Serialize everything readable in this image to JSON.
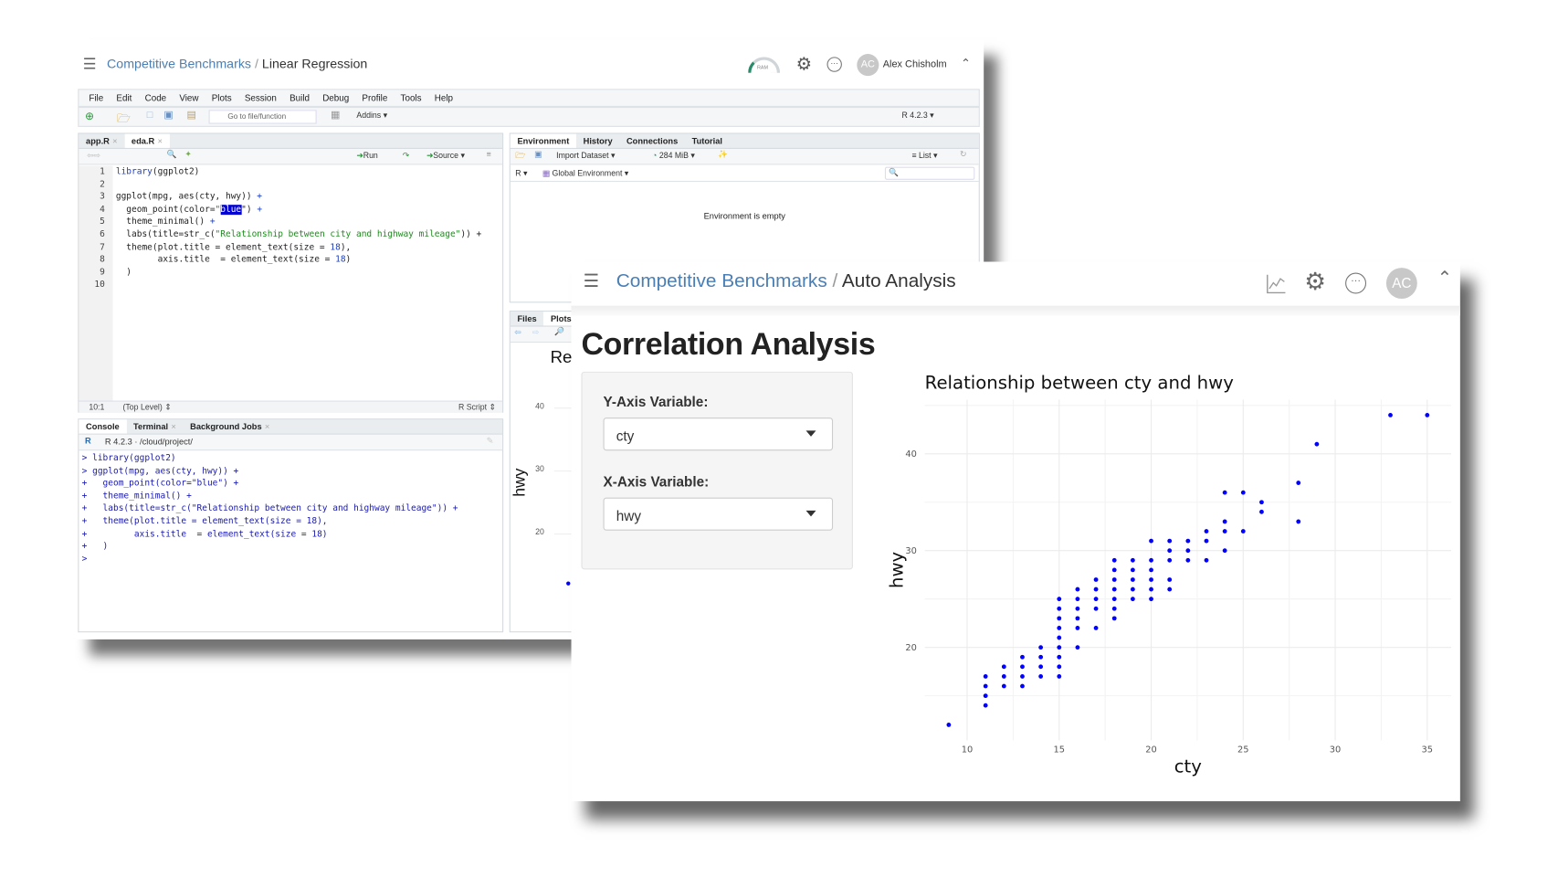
{
  "back_window": {
    "breadcrumb_parent": "Competitive Benchmarks",
    "breadcrumb_sep": "/",
    "breadcrumb_current": "Linear Regression",
    "ram_label": "RAM",
    "user_initials": "AC",
    "user_name": "Alex Chisholm",
    "menu": [
      "File",
      "Edit",
      "Code",
      "View",
      "Plots",
      "Session",
      "Build",
      "Debug",
      "Profile",
      "Tools",
      "Help"
    ],
    "toolbar": {
      "goto_placeholder": "Go to file/function",
      "addins": "Addins",
      "r_version": "R 4.2.3"
    },
    "editor": {
      "tabs": [
        "app.R",
        "eda.R"
      ],
      "run": "Run",
      "source": "Source",
      "line_numbers": [
        "1",
        "2",
        "3",
        "4",
        "5",
        "6",
        "7",
        "8",
        "9",
        "10"
      ],
      "lines": [
        [
          {
            "t": "library",
            "c": "kw"
          },
          {
            "t": "(ggplot2)",
            "c": ""
          }
        ],
        [],
        [
          {
            "t": "ggplot(mpg, aes(cty, hwy)) ",
            "c": ""
          },
          {
            "t": "+",
            "c": "kw"
          }
        ],
        [
          {
            "t": "  geom_point(color=",
            "c": ""
          },
          {
            "t": "\"",
            "c": "str"
          },
          {
            "t": "blue",
            "c": "hl"
          },
          {
            "t": "\") ",
            "c": ""
          },
          {
            "t": "+",
            "c": "kw"
          }
        ],
        [
          {
            "t": "  theme_minimal() ",
            "c": ""
          },
          {
            "t": "+",
            "c": "kw"
          }
        ],
        [
          {
            "t": "  labs(title=str_c(",
            "c": ""
          },
          {
            "t": "\"Relationship between city and highway mileage\"",
            "c": "str"
          },
          {
            "t": ")) +",
            "c": ""
          }
        ],
        [
          {
            "t": "  theme(plot.title = element_text(size = ",
            "c": ""
          },
          {
            "t": "18",
            "c": "num"
          },
          {
            "t": "),",
            "c": ""
          }
        ],
        [
          {
            "t": "        axis.title  = element_text(size = ",
            "c": ""
          },
          {
            "t": "18",
            "c": "num"
          },
          {
            "t": ")",
            "c": ""
          }
        ],
        [
          {
            "t": "  )",
            "c": ""
          }
        ],
        []
      ],
      "cursor_pos": "10:1",
      "scope": "(Top Level)",
      "file_type": "R Script"
    },
    "console": {
      "tabs": [
        "Console",
        "Terminal",
        "Background Jobs"
      ],
      "path": "R 4.2.3 · /cloud/project/",
      "lines": [
        "> library(ggplot2)",
        "> ggplot(mpg, aes(cty, hwy)) +",
        "+   geom_point(color=\"blue\") +",
        "+   theme_minimal() +",
        "+   labs(title=str_c(\"Relationship between city and highway mileage\")) +",
        "+   theme(plot.title = element_text(size = 18),",
        "+         axis.title  = element_text(size = 18)",
        "+   )",
        "> "
      ]
    },
    "environment": {
      "tabs": [
        "Environment",
        "History",
        "Connections",
        "Tutorial"
      ],
      "import_dataset": "Import Dataset",
      "memory": "284 MiB",
      "view_mode": "List",
      "language": "R",
      "scope": "Global Environment",
      "empty_message": "Environment is empty"
    },
    "files_pane": {
      "tabs": [
        "Files",
        "Plots"
      ],
      "plot_title_fragment": "Re",
      "y_ticks": [
        "40",
        "30",
        "20"
      ],
      "ylabel": "hwy"
    }
  },
  "front_window": {
    "breadcrumb_parent": "Competitive Benchmarks",
    "breadcrumb_sep": "/",
    "breadcrumb_current": "Auto Analysis",
    "user_initials": "AC",
    "page_title": "Correlation Analysis",
    "y_axis_label": "Y-Axis Variable:",
    "y_axis_value": "cty",
    "x_axis_label": "X-Axis Variable:",
    "x_axis_value": "hwy"
  },
  "chart_data": {
    "type": "scatter",
    "title": "Relationship between cty and hwy",
    "xlabel": "cty",
    "ylabel": "hwy",
    "xlim": [
      7.7,
      36.3
    ],
    "ylim": [
      10.4,
      45.6
    ],
    "x_ticks": [
      10,
      15,
      20,
      25,
      30,
      35
    ],
    "y_ticks": [
      20,
      30,
      40
    ],
    "grid": true,
    "point_color": "#0000ff",
    "points": [
      [
        9,
        12
      ],
      [
        11,
        17
      ],
      [
        11,
        16
      ],
      [
        11,
        15
      ],
      [
        11,
        14
      ],
      [
        12,
        18
      ],
      [
        12,
        17
      ],
      [
        12,
        16
      ],
      [
        13,
        19
      ],
      [
        13,
        18
      ],
      [
        13,
        17
      ],
      [
        13,
        16
      ],
      [
        14,
        20
      ],
      [
        14,
        19
      ],
      [
        14,
        18
      ],
      [
        14,
        17
      ],
      [
        15,
        25
      ],
      [
        15,
        24
      ],
      [
        15,
        23
      ],
      [
        15,
        22
      ],
      [
        15,
        21
      ],
      [
        15,
        20
      ],
      [
        15,
        19
      ],
      [
        15,
        18
      ],
      [
        15,
        17
      ],
      [
        16,
        26
      ],
      [
        16,
        25
      ],
      [
        16,
        24
      ],
      [
        16,
        23
      ],
      [
        16,
        22
      ],
      [
        16,
        20
      ],
      [
        17,
        27
      ],
      [
        17,
        26
      ],
      [
        17,
        25
      ],
      [
        17,
        24
      ],
      [
        17,
        22
      ],
      [
        18,
        29
      ],
      [
        18,
        28
      ],
      [
        18,
        27
      ],
      [
        18,
        26
      ],
      [
        18,
        25
      ],
      [
        18,
        24
      ],
      [
        18,
        23
      ],
      [
        19,
        29
      ],
      [
        19,
        28
      ],
      [
        19,
        27
      ],
      [
        19,
        26
      ],
      [
        19,
        25
      ],
      [
        20,
        31
      ],
      [
        20,
        29
      ],
      [
        20,
        28
      ],
      [
        20,
        27
      ],
      [
        20,
        26
      ],
      [
        20,
        25
      ],
      [
        21,
        31
      ],
      [
        21,
        30
      ],
      [
        21,
        29
      ],
      [
        21,
        27
      ],
      [
        21,
        26
      ],
      [
        22,
        31
      ],
      [
        22,
        30
      ],
      [
        22,
        29
      ],
      [
        23,
        32
      ],
      [
        23,
        31
      ],
      [
        23,
        29
      ],
      [
        24,
        36
      ],
      [
        24,
        33
      ],
      [
        24,
        32
      ],
      [
        24,
        30
      ],
      [
        25,
        36
      ],
      [
        25,
        32
      ],
      [
        26,
        35
      ],
      [
        26,
        34
      ],
      [
        28,
        37
      ],
      [
        28,
        33
      ],
      [
        29,
        41
      ],
      [
        33,
        44
      ],
      [
        35,
        44
      ]
    ]
  }
}
